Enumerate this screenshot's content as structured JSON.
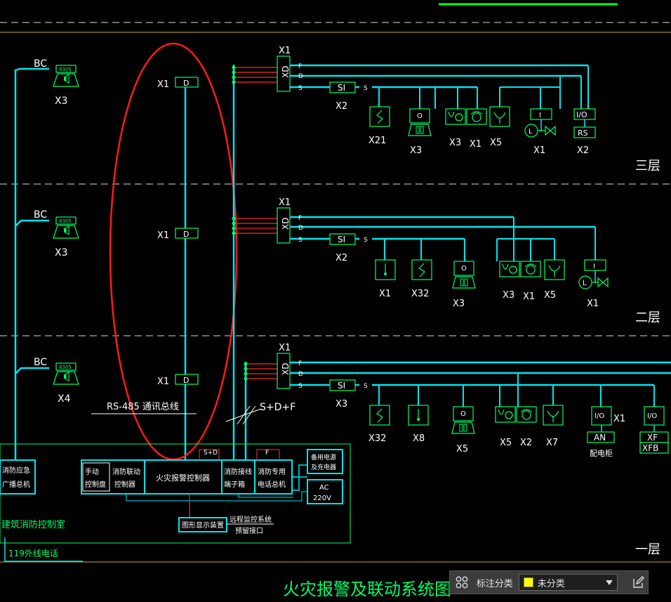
{
  "floors": {
    "third": "三层",
    "second": "二层",
    "first": "一层"
  },
  "diagram_title": "火灾报警及联动系统图",
  "bus": {
    "rs485": "RS-485 通讯总线",
    "sdf": "S+D+F"
  },
  "speakers": [
    {
      "bc": "BC",
      "tag": "8305",
      "qty": "X3"
    },
    {
      "bc": "BC",
      "tag": "8305",
      "qty": "X3"
    },
    {
      "bc": "BC",
      "tag": "8305",
      "qty": "X4"
    }
  ],
  "display_units": {
    "label": "X1",
    "box": "D"
  },
  "xd": {
    "top": "X1",
    "box": "XD",
    "f": "F",
    "d": "D",
    "s": "S"
  },
  "si": {
    "box": "SI",
    "s": "S"
  },
  "third_floor": {
    "si_qty": "X2",
    "dev": {
      "x21": "X21",
      "o_x3": "X3",
      "o_box": "O",
      "x3": "X3",
      "x1a": "X1",
      "x5": "X5",
      "i_box": "I",
      "l_box": "L",
      "x1b": "X1",
      "io_box": "I/O",
      "rs_box": "RS",
      "x2": "X2"
    }
  },
  "second_floor": {
    "si_qty": "X2",
    "dev": {
      "x1": "X1",
      "x32": "X32",
      "o_box": "O",
      "o_x3": "X3",
      "x3": "X3",
      "x1a": "X1",
      "x5": "X5",
      "i_box": "I",
      "l_box": "L",
      "x1b": "X1"
    }
  },
  "first_floor": {
    "si_qty": "X3",
    "dev": {
      "x32": "X32",
      "x8": "X8",
      "o_box": "O",
      "x5o": "X5",
      "x5": "X5",
      "x2": "X2",
      "x7": "X7",
      "io1": "I/O",
      "x1": "X1",
      "an": "AN",
      "an_label": "配电柜",
      "io2": "I/O",
      "xf": "XF",
      "xfb": "XFB"
    }
  },
  "control_room": {
    "broadcast": [
      "消防应急",
      "广播总机"
    ],
    "manual": [
      "手动",
      "控制盘"
    ],
    "linkage": [
      "消防联动",
      "控制器"
    ],
    "controller": "火灾报警控制器",
    "sd_tag": "S+D",
    "f_tag": "F",
    "terminal": [
      "消防接线",
      "端子箱"
    ],
    "phone": [
      "消防专用",
      "电话总机"
    ],
    "backup": [
      "备用电源",
      "及充电器"
    ],
    "ac": [
      "AC",
      "220V"
    ],
    "graphic": "图形显示装置",
    "remote": [
      "远程监控系统",
      "预留接口"
    ],
    "room_name": "建筑消防控制室",
    "phone_line": "119外线电话"
  },
  "toolbar": {
    "label": "标注分类",
    "selected": "未分类",
    "swatch_color": "#ffff00"
  },
  "colors": {
    "bus": "#00e5ee",
    "device": "#00ff66",
    "highlight": "#ff1a1a",
    "text": "#ffffff",
    "divider": "#dcdcdc",
    "room_text": "#00ff66"
  }
}
